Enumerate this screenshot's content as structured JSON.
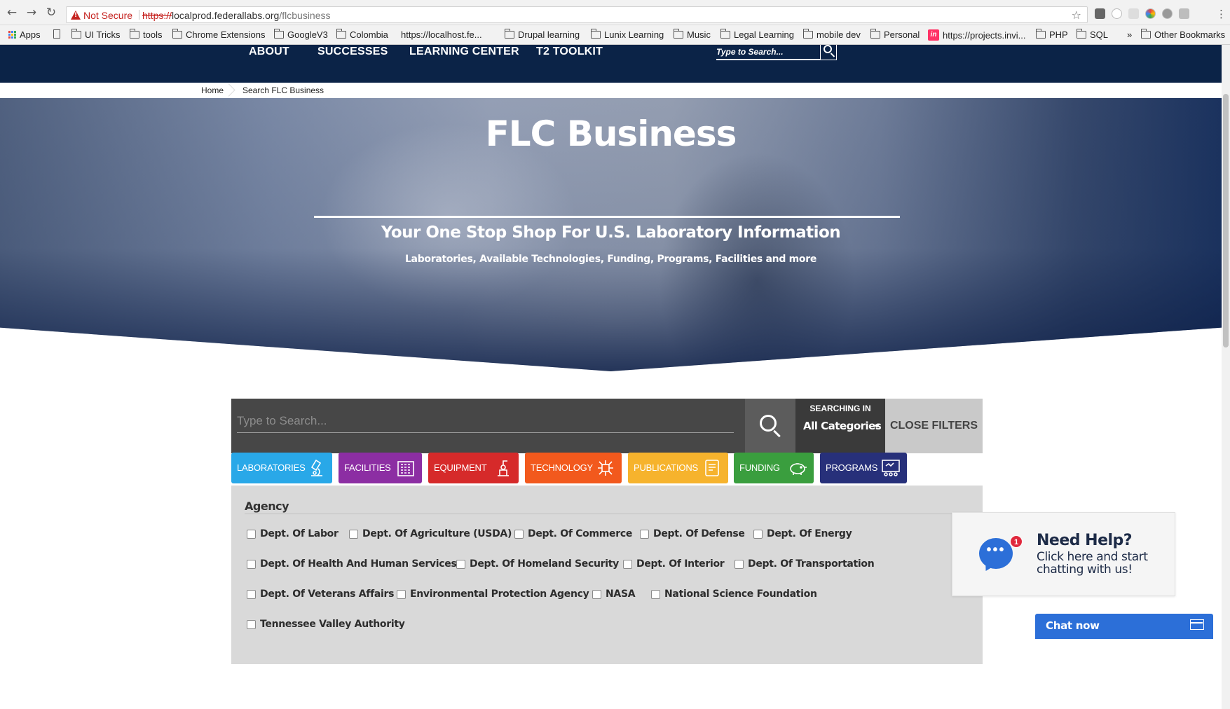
{
  "browser": {
    "security_label": "Not Secure",
    "url_scheme": "https://",
    "url_host": "localprod.federallabs.org",
    "url_path": "/flcbusiness",
    "bookmarks": [
      "Apps",
      "UI Tricks",
      "tools",
      "Chrome Extensions",
      "GoogleV3",
      "Colombia",
      "https://localhost.fe...",
      "Drupal learning",
      "Lunix Learning",
      "Music",
      "Legal Learning",
      "mobile dev",
      "Personal",
      "https://projects.invi...",
      "PHP",
      "SQL",
      "»",
      "Other Bookmarks"
    ]
  },
  "site_nav": {
    "links": [
      "ABOUT",
      "SUCCESSES",
      "LEARNING CENTER",
      "T2 TOOLKIT"
    ],
    "search_placeholder": "Type to Search..."
  },
  "breadcrumb": [
    "Home",
    "Search FLC Business"
  ],
  "hero": {
    "title": "FLC Business",
    "subtitle": "Your One Stop Shop For U.S. Laboratory Information",
    "tagline": "Laboratories, Available Technologies, Funding, Programs, Facilities and more"
  },
  "search": {
    "placeholder": "Type to Search...",
    "searching_in_label": "SEARCHING IN",
    "category_value": "All Categories",
    "close_filters_label": "CLOSE FILTERS"
  },
  "categories": [
    {
      "label": "LABORATORIES",
      "color": "#29a8e8",
      "icon": "microscope-icon"
    },
    {
      "label": "FACILITIES",
      "color": "#8c2ea3",
      "icon": "building-icon"
    },
    {
      "label": "EQUIPMENT",
      "color": "#d62a2a",
      "icon": "equipment-icon"
    },
    {
      "label": "TECHNOLOGY",
      "color": "#f2591d",
      "icon": "circuit-icon"
    },
    {
      "label": "PUBLICATIONS",
      "color": "#f6b32d",
      "icon": "document-icon"
    },
    {
      "label": "FUNDING",
      "color": "#3a9e3e",
      "icon": "piggy-bank-icon"
    },
    {
      "label": "PROGRAMS",
      "color": "#27307a",
      "icon": "presentation-icon"
    }
  ],
  "filters": {
    "title": "Agency",
    "agencies": [
      "Dept. Of Labor",
      "Dept. Of Agriculture (USDA)",
      "Dept. Of Commerce",
      "Dept. Of Defense",
      "Dept. Of Energy",
      "Dept. Of Health And Human Services",
      "Dept. Of Homeland Security",
      "Dept. Of Interior",
      "Dept. Of Transportation",
      "Dept. Of Veterans Affairs",
      "Environmental Protection Agency",
      "NASA",
      "National Science Foundation",
      "Tennessee Valley Authority"
    ]
  },
  "chat": {
    "help_title": "Need Help?",
    "help_text": "Click here and start chatting with us!",
    "badge_count": "1",
    "chat_now_label": "Chat now"
  }
}
